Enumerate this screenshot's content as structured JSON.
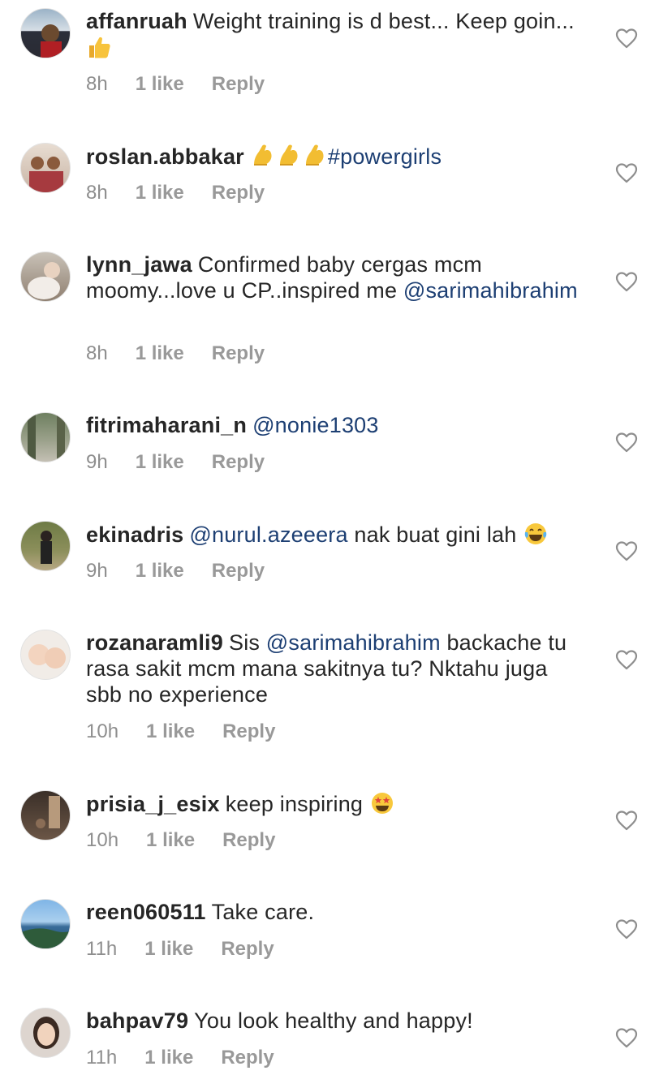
{
  "comments": [
    {
      "username": "affanruah",
      "text": "Weight training is d best... Keep goin...",
      "time": "8h",
      "likes": "1 like",
      "reply": "Reply"
    },
    {
      "username": "roslan.abbakar",
      "hashtag": "#powergirls",
      "time": "8h",
      "likes": "1 like",
      "reply": "Reply"
    },
    {
      "username": "lynn_jawa",
      "text": "Confirmed baby cergas mcm moomy...love u CP..inspired me",
      "mention": "@sarimahibrahim",
      "time": "8h",
      "likes": "1 like",
      "reply": "Reply"
    },
    {
      "username": "fitrimaharani_n",
      "mention": "@nonie1303",
      "time": "9h",
      "likes": "1 like",
      "reply": "Reply"
    },
    {
      "username": "ekinadris",
      "mention": "@nurul.azeeera",
      "text": "nak buat gini lah",
      "time": "9h",
      "likes": "1 like",
      "reply": "Reply"
    },
    {
      "username": "rozanaramli9",
      "text_before": "Sis",
      "mention": "@sarimahibrahim",
      "text": "backache tu rasa sakit mcm mana sakitnya tu? Nktahu juga sbb no experience",
      "time": "10h",
      "likes": "1 like",
      "reply": "Reply"
    },
    {
      "username": "prisia_j_esix",
      "text": "keep inspiring",
      "time": "10h",
      "likes": "1 like",
      "reply": "Reply"
    },
    {
      "username": "reen060511",
      "text": "Take care.",
      "time": "11h",
      "likes": "1 like",
      "reply": "Reply"
    },
    {
      "username": "bahpav79",
      "text": "You look healthy and happy!",
      "time": "11h",
      "likes": "1 like",
      "reply": "Reply"
    }
  ],
  "icons": {
    "like": "heart-outline-icon",
    "thumbs_up": "thumbs-up-emoji",
    "flex": "flexed-biceps-emoji",
    "laugh": "tears-of-joy-emoji",
    "star_eyes": "star-struck-emoji"
  },
  "colors": {
    "mention": "#1d3f73",
    "meta": "#8e8e8e",
    "text": "#262626"
  }
}
